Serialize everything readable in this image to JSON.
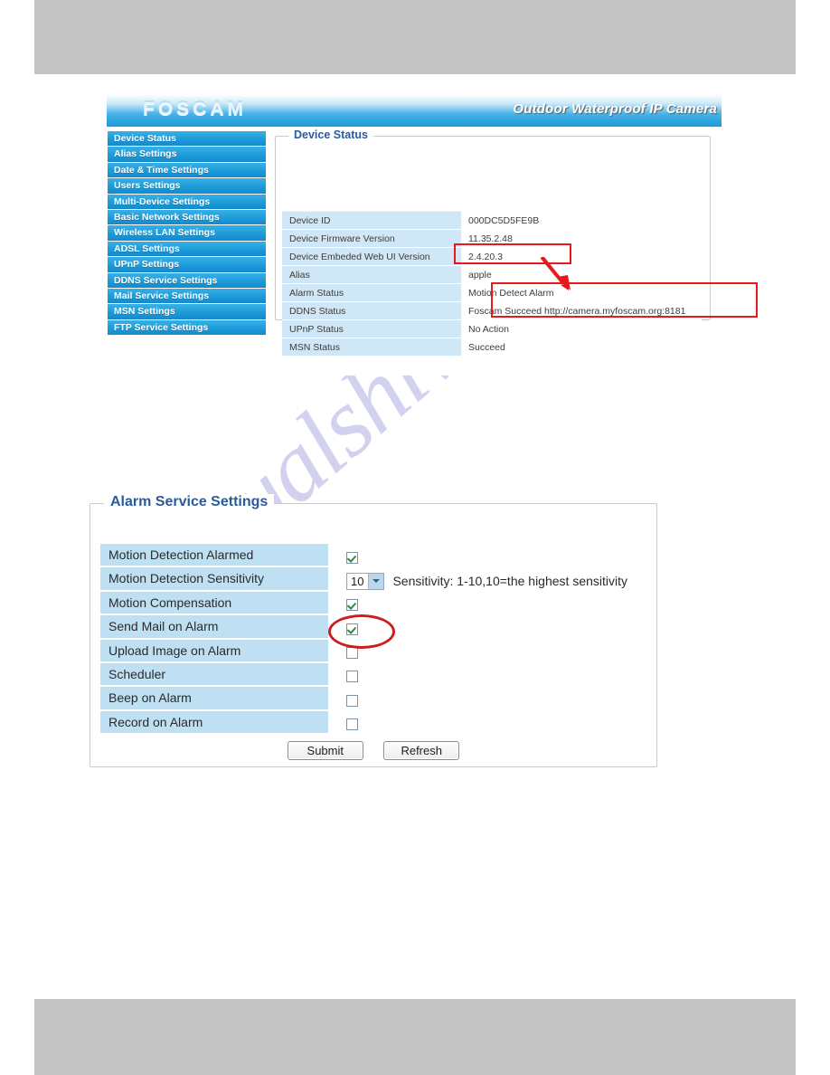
{
  "header": {
    "logo_text": "FOSCAM",
    "tagline": "Outdoor Waterproof IP Camera"
  },
  "watermark": {
    "text": "manualshive.com"
  },
  "sidebar": {
    "items": [
      {
        "label": "Device Status"
      },
      {
        "label": "Alias Settings"
      },
      {
        "label": "Date & Time Settings"
      },
      {
        "label": "Users Settings"
      },
      {
        "label": "Multi-Device Settings"
      },
      {
        "label": "Basic Network Settings"
      },
      {
        "label": "Wireless LAN Settings"
      },
      {
        "label": "ADSL Settings"
      },
      {
        "label": "UPnP Settings"
      },
      {
        "label": "DDNS Service Settings"
      },
      {
        "label": "Mail Service Settings"
      },
      {
        "label": "MSN Settings"
      },
      {
        "label": "FTP Service Settings"
      }
    ]
  },
  "device_status": {
    "title": "Device Status",
    "rows": [
      {
        "key": "Device ID",
        "value": "000DC5D5FE9B"
      },
      {
        "key": "Device Firmware Version",
        "value": "11.35.2.48"
      },
      {
        "key": "Device Embeded Web UI Version",
        "value": "2.4.20.3"
      },
      {
        "key": "Alias",
        "value": "apple"
      },
      {
        "key": "Alarm Status",
        "value": "Motion Detect Alarm"
      },
      {
        "key": "DDNS Status",
        "value": "Foscam Succeed  http://camera.myfoscam.org:8181"
      },
      {
        "key": "UPnP Status",
        "value": "No Action"
      },
      {
        "key": "MSN Status",
        "value": "Succeed"
      }
    ]
  },
  "alarm_settings": {
    "title": "Alarm Service Settings",
    "rows": [
      {
        "label": "Motion Detection Alarmed",
        "type": "checkbox",
        "checked": true
      },
      {
        "label": "Motion Detection Sensitivity",
        "type": "select",
        "value": "10",
        "hint": "Sensitivity: 1-10,10=the highest sensitivity"
      },
      {
        "label": "Motion Compensation",
        "type": "checkbox",
        "checked": true
      },
      {
        "label": "Send Mail on Alarm",
        "type": "checkbox",
        "checked": true
      },
      {
        "label": "Upload Image on Alarm",
        "type": "checkbox",
        "checked": false
      },
      {
        "label": "Scheduler",
        "type": "checkbox",
        "checked": false
      },
      {
        "label": "Beep on Alarm",
        "type": "checkbox",
        "checked": false
      },
      {
        "label": "Record on Alarm",
        "type": "checkbox",
        "checked": false
      }
    ],
    "submit_label": "Submit",
    "refresh_label": "Refresh"
  },
  "annotation": {
    "color": "#e8191b"
  }
}
